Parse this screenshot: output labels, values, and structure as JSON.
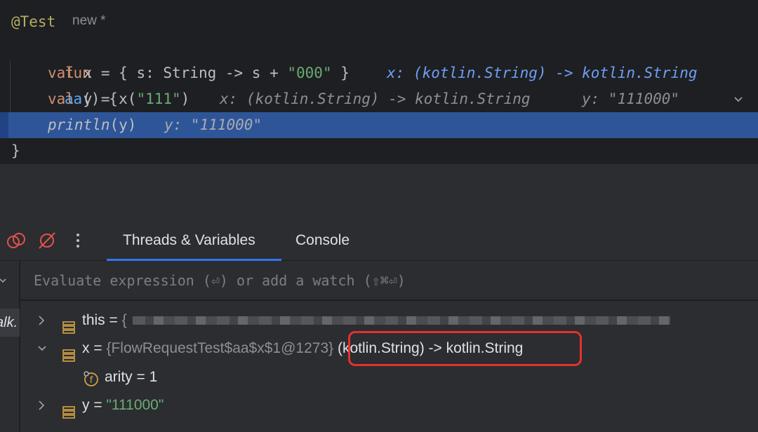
{
  "editor": {
    "annotation": "@Test",
    "new_label": "new *",
    "line2": {
      "kw": "fun",
      "name": "aa",
      "rest": "() {"
    },
    "line3": {
      "kw": "val",
      "code": " x = { s: String -> s + ",
      "str": "\"000\"",
      "end": " }",
      "hint": "x: (kotlin.String) -> kotlin.String"
    },
    "line4": {
      "kw": "val",
      "code": " y = x(",
      "str": "\"111\"",
      "end": ")",
      "hint1": "x: (kotlin.String) -> kotlin.String",
      "hint2": "y: \"111000\""
    },
    "line5": {
      "fn": "println",
      "args": "(y)",
      "hint": "y: \"111000\""
    },
    "line6": "}"
  },
  "debugger": {
    "tabs": [
      "Threads & Variables",
      "Console"
    ],
    "side_label": "alk.",
    "evaluate_placeholder": "Evaluate expression (⏎) or add a watch (⇧⌘⏎)",
    "variables": [
      {
        "name": "this",
        "eq": " = ",
        "value_hidden": "{"
      },
      {
        "name": "x",
        "eq": " = ",
        "type": "{FlowRequestTest$aa$x$1@1273}",
        "value": " (kotlin.String) -> kotlin.String"
      },
      {
        "name": "arity",
        "eq": " = ",
        "value": "1"
      },
      {
        "name": "y",
        "eq": " = ",
        "value": "\"111000\""
      }
    ]
  },
  "colors": {
    "accent": "#3574f0",
    "highlight": "#2e5597",
    "callout": "#e5312b"
  }
}
